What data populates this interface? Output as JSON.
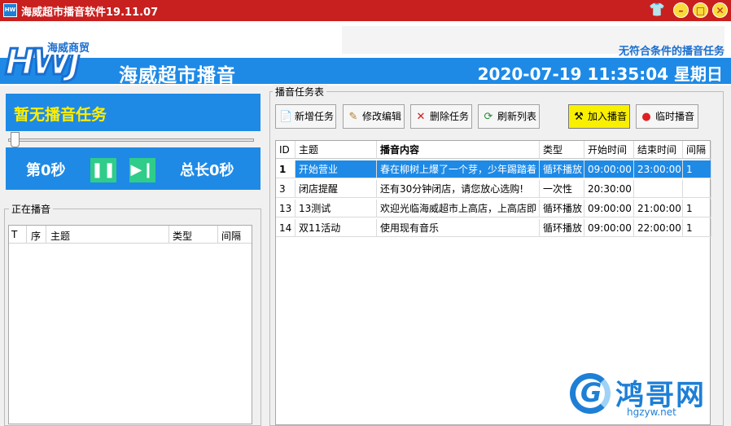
{
  "window": {
    "title": "海威超市播音软件19.11.07",
    "icon_text": "HW"
  },
  "header": {
    "logo_letters": "HWJ",
    "logo_tag": "海威商贸",
    "brand": "海威超市播音",
    "status": "无符合条件的播音任务",
    "datetime": "2020-07-19 11:35:04 星期日"
  },
  "left": {
    "now_playing_text": "暂无播音任务",
    "elapsed": "第0秒",
    "total": "总长0秒",
    "playing_group_label": "正在播音",
    "playing_columns": [
      "T",
      "序",
      "主题",
      "类型",
      "间隔"
    ],
    "slider_level": 0
  },
  "right": {
    "group_label": "播音任务表",
    "toolbar": [
      "新增任务",
      "修改编辑",
      "删除任务",
      "刷新列表",
      "加入播音",
      "临时播音"
    ],
    "columns": [
      "ID",
      "主题",
      "播音内容",
      "类型",
      "开始时间",
      "结束时间",
      "间隔"
    ],
    "rows": [
      [
        "1",
        "开始营业",
        "春在柳树上爆了一个芽，少年踢踏着",
        "循环播放",
        "09:00:00",
        "23:00:00",
        "1"
      ],
      [
        "3",
        "闭店提醒",
        "还有30分钟闭店，请您放心选购!",
        "一次性",
        "20:30:00",
        "",
        ""
      ],
      [
        "13",
        "13测试",
        "欢迎光临海威超市上高店，上高店即",
        "循环播放",
        "09:00:00",
        "21:00:00",
        "1"
      ],
      [
        "14",
        "双11活动",
        "使用现有音乐",
        "循环播放",
        "09:00:00",
        "22:00:00",
        "1"
      ]
    ]
  },
  "watermark": {
    "title": "鸿哥网",
    "url": "hgzyw.net"
  },
  "colors": {
    "titlebar": "#c8201f",
    "accent_blue": "#1e8ae6",
    "now_text": "#ffee00",
    "play_green": "#2fcc8a",
    "highlight_button": "#f8f000"
  },
  "icons": [
    "shirt-icon",
    "minimize-icon",
    "maximize-icon",
    "close-icon",
    "pause-icon",
    "next-icon",
    "add-icon",
    "edit-icon",
    "delete-icon",
    "refresh-icon",
    "tools-icon",
    "record-icon"
  ]
}
